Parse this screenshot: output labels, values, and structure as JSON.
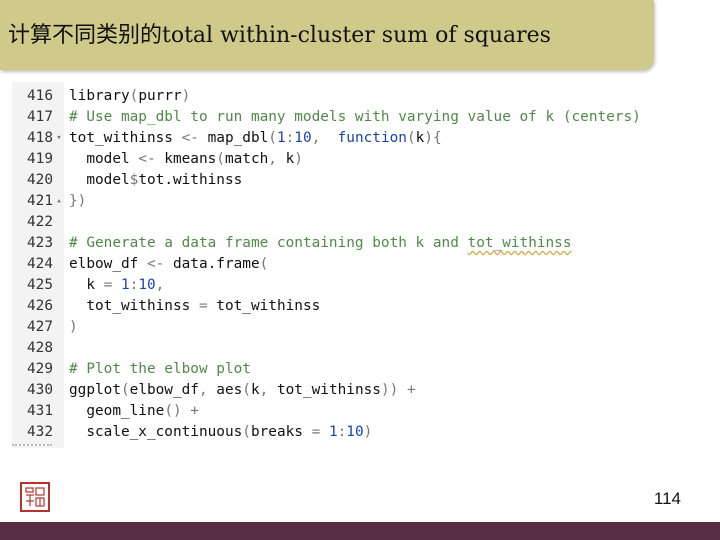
{
  "title": "计算不同类别的total within-cluster sum of squares",
  "code_lines": [
    {
      "num": "416",
      "fold": "",
      "tokens": [
        [
          "t-plain",
          "library"
        ],
        [
          "t-op",
          "("
        ],
        [
          "t-plain",
          "purrr"
        ],
        [
          "t-op",
          ")"
        ]
      ]
    },
    {
      "num": "417",
      "fold": "",
      "tokens": [
        [
          "t-comment",
          "# Use map_dbl to run many models with varying value of k (centers)"
        ]
      ]
    },
    {
      "num": "418",
      "fold": "▾",
      "tokens": [
        [
          "t-plain",
          "tot_withinss "
        ],
        [
          "t-op",
          "<-"
        ],
        [
          "t-plain",
          " map_dbl"
        ],
        [
          "t-op",
          "("
        ],
        [
          "t-number",
          "1"
        ],
        [
          "t-op",
          ":"
        ],
        [
          "t-number",
          "10"
        ],
        [
          "t-op",
          ","
        ],
        [
          "t-plain",
          "  "
        ],
        [
          "t-keyword",
          "function"
        ],
        [
          "t-op",
          "("
        ],
        [
          "t-plain",
          "k"
        ],
        [
          "t-op",
          ")"
        ],
        [
          "t-op",
          "{"
        ]
      ]
    },
    {
      "num": "419",
      "fold": "",
      "tokens": [
        [
          "t-plain",
          "  model "
        ],
        [
          "t-op",
          "<-"
        ],
        [
          "t-plain",
          " kmeans"
        ],
        [
          "t-op",
          "("
        ],
        [
          "t-plain",
          "match"
        ],
        [
          "t-op",
          ","
        ],
        [
          "t-plain",
          " k"
        ],
        [
          "t-op",
          ")"
        ]
      ]
    },
    {
      "num": "420",
      "fold": "",
      "tokens": [
        [
          "t-plain",
          "  model"
        ],
        [
          "t-op",
          "$"
        ],
        [
          "t-plain",
          "tot.withinss"
        ]
      ]
    },
    {
      "num": "421",
      "fold": "▴",
      "tokens": [
        [
          "t-op",
          "})"
        ]
      ]
    },
    {
      "num": "422",
      "fold": "",
      "tokens": []
    },
    {
      "num": "423",
      "fold": "",
      "tokens": [
        [
          "t-comment",
          "# Generate a data frame containing both k and "
        ],
        [
          "t-comment t-squiggle",
          "tot_withinss"
        ]
      ]
    },
    {
      "num": "424",
      "fold": "",
      "tokens": [
        [
          "t-plain",
          "elbow_df "
        ],
        [
          "t-op",
          "<-"
        ],
        [
          "t-plain",
          " data.frame"
        ],
        [
          "t-op",
          "("
        ]
      ]
    },
    {
      "num": "425",
      "fold": "",
      "tokens": [
        [
          "t-plain",
          "  k "
        ],
        [
          "t-op",
          "="
        ],
        [
          "t-plain",
          " "
        ],
        [
          "t-number",
          "1"
        ],
        [
          "t-op",
          ":"
        ],
        [
          "t-number",
          "10"
        ],
        [
          "t-op",
          ","
        ]
      ]
    },
    {
      "num": "426",
      "fold": "",
      "tokens": [
        [
          "t-plain",
          "  tot_withinss "
        ],
        [
          "t-op",
          "="
        ],
        [
          "t-plain",
          " tot_withinss"
        ]
      ]
    },
    {
      "num": "427",
      "fold": "",
      "tokens": [
        [
          "t-op",
          ")"
        ]
      ]
    },
    {
      "num": "428",
      "fold": "",
      "tokens": []
    },
    {
      "num": "429",
      "fold": "",
      "tokens": [
        [
          "t-comment",
          "# Plot the elbow plot"
        ]
      ]
    },
    {
      "num": "430",
      "fold": "",
      "tokens": [
        [
          "t-plain",
          "ggplot"
        ],
        [
          "t-op",
          "("
        ],
        [
          "t-plain",
          "elbow_df"
        ],
        [
          "t-op",
          ","
        ],
        [
          "t-plain",
          " aes"
        ],
        [
          "t-op",
          "("
        ],
        [
          "t-plain",
          "k"
        ],
        [
          "t-op",
          ","
        ],
        [
          "t-plain",
          " tot_withinss"
        ],
        [
          "t-op",
          "))"
        ],
        [
          "t-plain",
          " "
        ],
        [
          "t-op",
          "+"
        ]
      ]
    },
    {
      "num": "431",
      "fold": "",
      "tokens": [
        [
          "t-plain",
          "  geom_line"
        ],
        [
          "t-op",
          "()"
        ],
        [
          "t-plain",
          " "
        ],
        [
          "t-op",
          "+"
        ]
      ]
    },
    {
      "num": "432",
      "fold": "",
      "tokens": [
        [
          "t-plain",
          "  scale_x_continuous"
        ],
        [
          "t-op",
          "("
        ],
        [
          "t-plain",
          "breaks "
        ],
        [
          "t-op",
          "="
        ],
        [
          "t-plain",
          " "
        ],
        [
          "t-number",
          "1"
        ],
        [
          "t-op",
          ":"
        ],
        [
          "t-number",
          "10"
        ],
        [
          "t-op",
          ")"
        ]
      ]
    }
  ],
  "page_number": "114",
  "colors": {
    "title_bg": "#cfc98a",
    "footer_bg": "#5a2d47",
    "comment": "#4f8a47",
    "keyword": "#1a41b8",
    "logo_red": "#b5332c"
  },
  "icons": {
    "fold_open": "fold-open-icon",
    "fold_close": "fold-close-icon",
    "logo": "seal-logo-icon"
  }
}
